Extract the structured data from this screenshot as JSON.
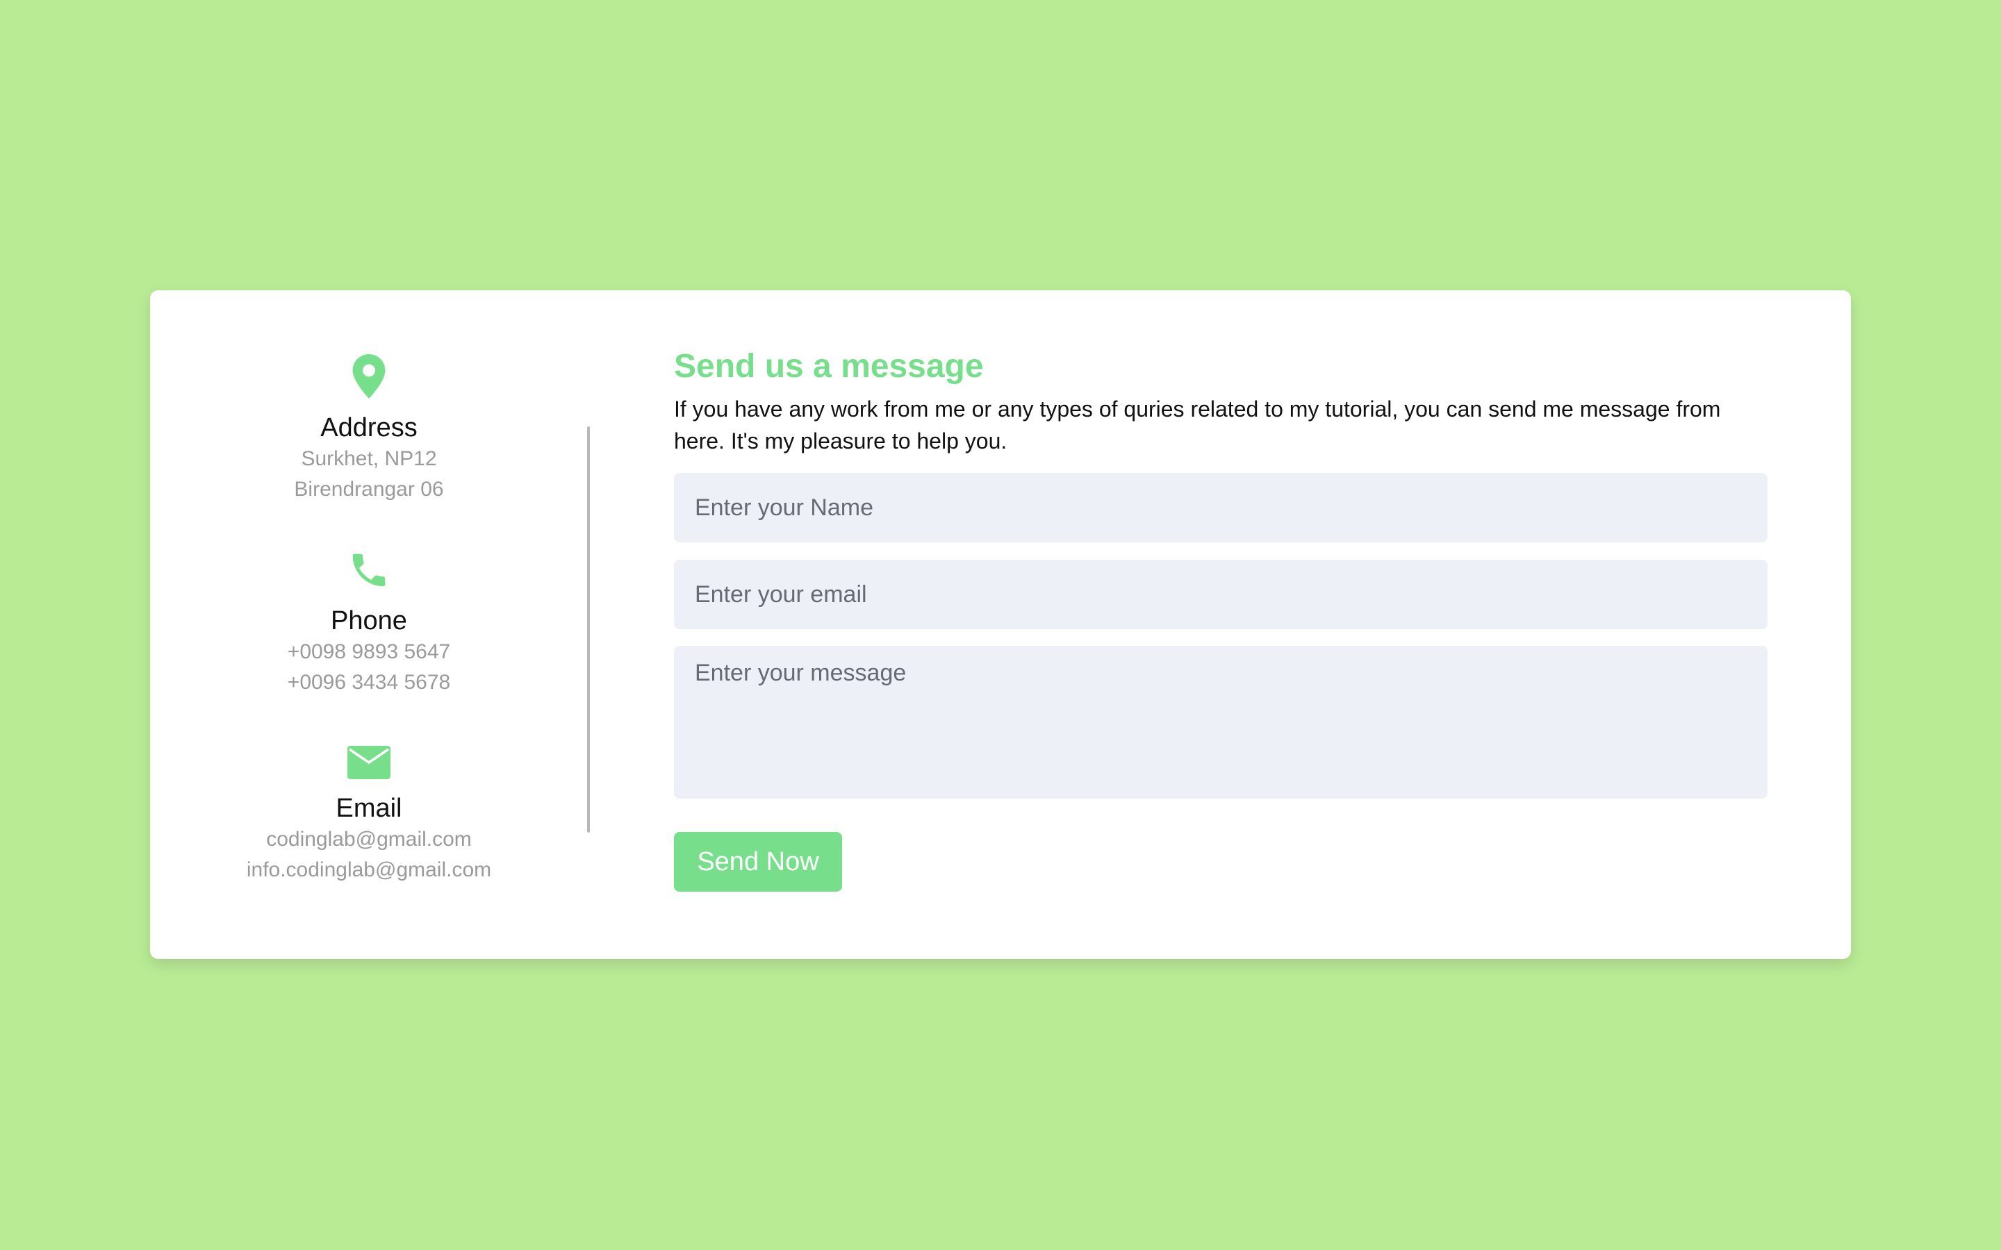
{
  "contact_info": {
    "address": {
      "icon": "map-pin-icon",
      "title": "Address",
      "lines": [
        "Surkhet, NP12",
        "Birendrangar 06"
      ]
    },
    "phone": {
      "icon": "phone-icon",
      "title": "Phone",
      "lines": [
        "+0098 9893 5647",
        "+0096 3434 5678"
      ]
    },
    "email": {
      "icon": "envelope-icon",
      "title": "Email",
      "lines": [
        "codinglab@gmail.com",
        "info.codinglab@gmail.com"
      ]
    }
  },
  "form": {
    "heading": "Send us a message",
    "description": "If you have any work from me or any types of quries related to my tutorial, you can send me message from here. It's my pleasure to help you.",
    "name_placeholder": "Enter your Name",
    "name_value": "",
    "email_placeholder": "Enter your email",
    "email_value": "",
    "message_placeholder": "Enter your message",
    "message_value": "",
    "submit_label": "Send Now"
  },
  "colors": {
    "page_background": "#b9eb95",
    "accent": "#77df8c",
    "input_background": "#eef0f8",
    "muted_text": "#9a9a9a"
  }
}
